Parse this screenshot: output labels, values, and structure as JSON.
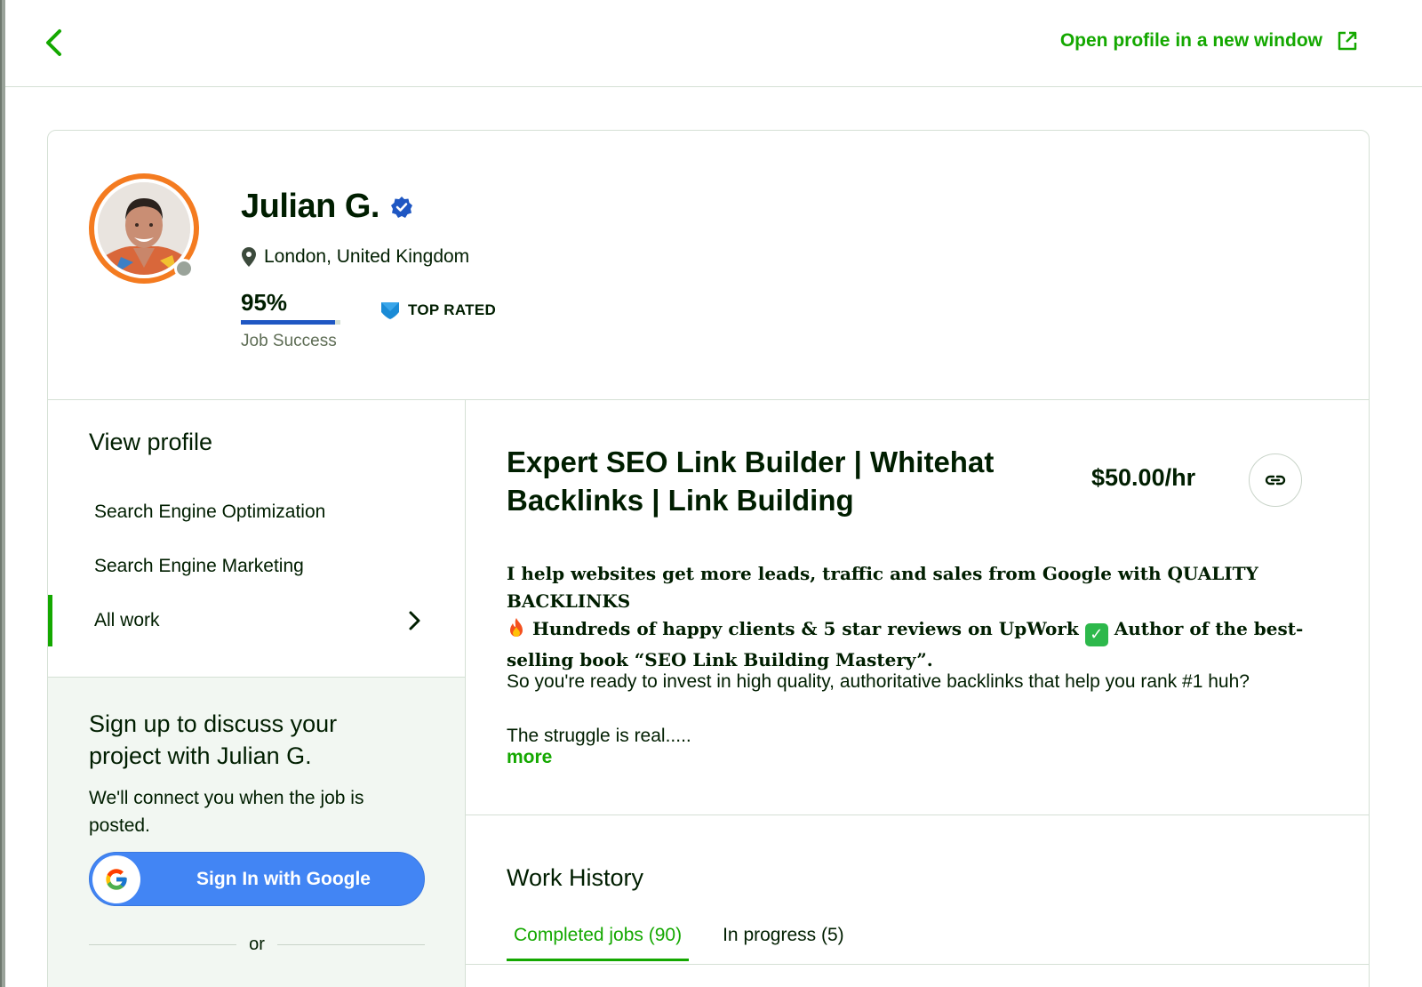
{
  "topbar": {
    "open_profile_label": "Open profile in a new window"
  },
  "profile": {
    "name": "Julian G.",
    "location": "London, United Kingdom",
    "job_success_value": "95%",
    "job_success_fraction": 0.95,
    "job_success_label": "Job Success",
    "badge_label": "TOP RATED",
    "online_status": "offline"
  },
  "sidebar": {
    "title": "View profile",
    "items": [
      {
        "label": "Search Engine Optimization"
      },
      {
        "label": "Search Engine Marketing"
      },
      {
        "label": "All work"
      }
    ]
  },
  "signup": {
    "title": "Sign up to discuss your project with Julian G.",
    "subtitle": "We'll connect you when the job is posted.",
    "google_button_label": "Sign In with Google",
    "or_label": "or"
  },
  "main": {
    "title": "Expert SEO Link Builder | Whitehat Backlinks | Link Building",
    "rate": "$50.00/hr",
    "description_line1": "I help websites get more leads, traffic and sales from Google with QUALITY BACKLINKS",
    "description_line2": " Hundreds of happy clients & 5 star reviews on UpWork ",
    "description_line2b": " Author of the best-selling book “SEO Link Building Mastery”.",
    "paragraph2": "So you're ready to invest in high quality, authoritative backlinks that help you rank #1 huh?",
    "paragraph3": "The struggle is real.....",
    "more_label": "more",
    "work_history_title": "Work History",
    "tabs": [
      {
        "label": "Completed jobs (90)",
        "active": true
      },
      {
        "label": "In progress (5)",
        "active": false
      }
    ]
  },
  "colors": {
    "accent": "#14a800",
    "avatar_ring": "#f47b20",
    "verified": "#1f57c3",
    "google_blue": "#4285f4",
    "top_rated_badge": "#1a8bd6"
  }
}
